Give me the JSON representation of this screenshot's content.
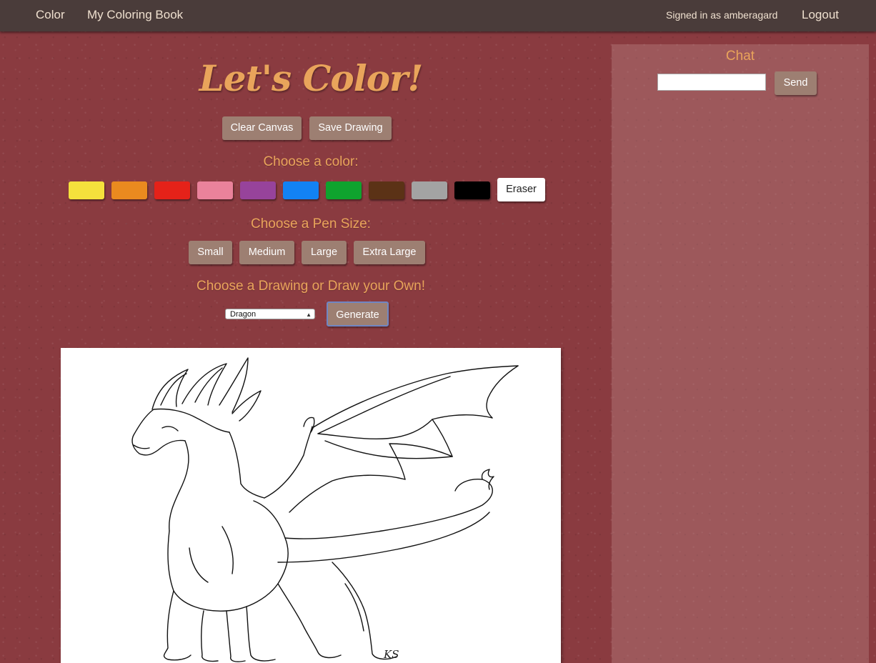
{
  "nav": {
    "color_link": "Color",
    "coloring_book_link": "My Coloring Book",
    "signed_in": "Signed in as amberagard",
    "logout": "Logout"
  },
  "main": {
    "title": "Let's Color!",
    "clear_canvas": "Clear Canvas",
    "save_drawing": "Save Drawing",
    "choose_color": "Choose a color:",
    "colors": [
      {
        "name": "yellow",
        "hex": "#f5e13c"
      },
      {
        "name": "orange",
        "hex": "#ea8a1f"
      },
      {
        "name": "red",
        "hex": "#e52219"
      },
      {
        "name": "pink",
        "hex": "#ea829b"
      },
      {
        "name": "purple",
        "hex": "#97439b"
      },
      {
        "name": "blue",
        "hex": "#1282f4"
      },
      {
        "name": "green",
        "hex": "#0fa32e"
      },
      {
        "name": "brown",
        "hex": "#5b3216"
      },
      {
        "name": "gray",
        "hex": "#a3a3a3"
      },
      {
        "name": "black",
        "hex": "#000000"
      }
    ],
    "eraser": "Eraser",
    "choose_pen_size": "Choose a Pen Size:",
    "pen_sizes": [
      "Small",
      "Medium",
      "Large",
      "Extra Large"
    ],
    "choose_drawing": "Choose a Drawing or Draw your Own!",
    "drawing_select_value": "Dragon",
    "generate": "Generate",
    "canvas_signature": "KS"
  },
  "chat": {
    "title": "Chat",
    "input_value": "",
    "send": "Send"
  },
  "colors": {
    "background": "#8a3b40",
    "navbar": "#4a3c3a",
    "accent": "#e9a45b",
    "button": "#9d7f72"
  }
}
